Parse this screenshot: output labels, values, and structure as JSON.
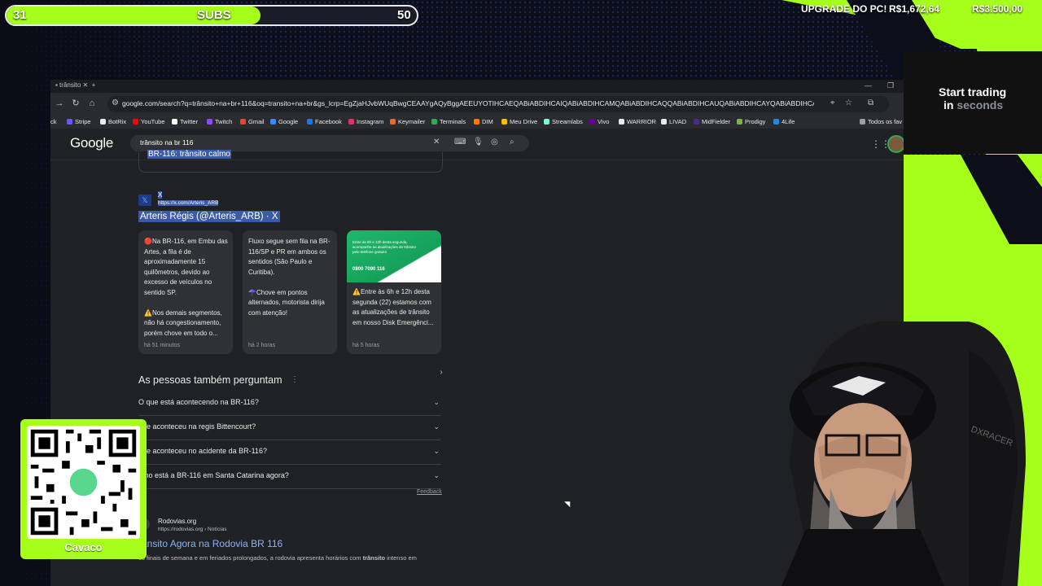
{
  "overlay": {
    "subs_current": "31",
    "subs_label": "SUBS",
    "subs_goal": "50",
    "subs_progress": 0.62,
    "goal_title": "UPGRADE DO PC!",
    "goal_current": "R$1,672,64",
    "goal_target": "R$3.500,00",
    "accent_color": "#a6ff1a",
    "qr_label": "Cavaco"
  },
  "ad": {
    "line1": "Start trading",
    "line2_prefix": "in",
    "line2_muted": "seconds"
  },
  "browser": {
    "url": "google.com/search?q=trânsito+na+br+116&oq=transito+na+br&gs_lcrp=EgZjaHJvbWUqBwgCEAAYgAQyBggAEEUYOTIHCAEQABiABDIHCAIQABiABDIHCAMQABiABDIHCAQQABiABDIHCAUQABiABDIHCAYQABiABDIHCAcQABiABDIHCAgQABiA...",
    "bookmarks": [
      "Stripe",
      "YouTube",
      "Twitter",
      "Twitch",
      "Gmail",
      "Google",
      "Facebook",
      "Instagram",
      "Keymailer",
      "Terminals",
      "DIM",
      "Meu Drive",
      "Streamlabs",
      "Vivo",
      "WARRIOR",
      "LIVAD",
      "MidFielder",
      "Prodigy",
      "4Life"
    ],
    "bookmarks_first": "BotRix",
    "bookmark_folder": "Todos os fav"
  },
  "google": {
    "logo": "Google",
    "query": "trânsito na br 116"
  },
  "results": {
    "prev_card_text": "BR-116: trânsito calmo",
    "x_name": "X",
    "x_url": "https://x.com/Arteris_ARB",
    "x_title": "Arteris Régis (@Arteris_ARB) · X",
    "posts": [
      {
        "text": "🔴Na BR-116, em Embu das Artes, a fila é de aproximadamente 15 quilômetros, devido ao excesso de veículos no sentido SP.\n\n⚠️Nos demais segmentos, não há congestionamento, porém chove em todo o...",
        "age": "há 51 minutos"
      },
      {
        "text": "Fluxo segue sem fila na BR-116/SP e PR em ambos os sentidos (São Paulo e Curitiba).\n\n☂️Chove em pontos alternados, motorista dirija com atenção!",
        "age": "há 2 horas"
      },
      {
        "text": "⚠️Entre às 6h e 12h desta segunda (22) estamos com as atualizações de trânsito em nosso Disk Emergênci...",
        "age": "há 5 horas",
        "img_caption": "Entre às 6h e 12h desta segunda, acompanhe as atualizações de trânsito pelo telefone gratuito",
        "img_phone": "0800 7090 116"
      }
    ],
    "paa_title": "As pessoas também perguntam",
    "paa": [
      "O que está acontecendo na BR-116?",
      "que aconteceu na regis Bittencourt?",
      "que aconteceu no acidente da BR-116?",
      "omo está a BR-116 em Santa Catarina agora?"
    ],
    "feedback": "Feedback",
    "r2_site": "Rodovias.org",
    "r2_url": "https://rodovias.org › Notícias",
    "r2_title": "rânsito Agora na Rodovia BR 116",
    "r2_snippet_a": "os finais de semana e em feriados prolongados, a rodovia apresenta horários com ",
    "r2_snippet_b": "trânsito",
    "r2_snippet_c": " intenso em"
  }
}
